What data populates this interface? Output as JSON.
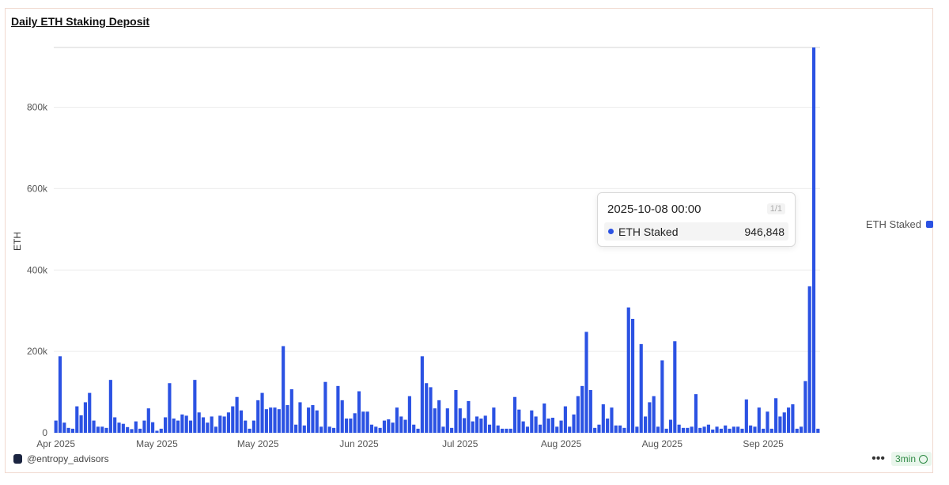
{
  "title": "Daily ETH Staking Deposit",
  "attribution": "@entropy_advisors",
  "refresh": "3min",
  "tooltip": {
    "date": "2025-10-08 00:00",
    "page": "1/1",
    "series": "ETH Staked",
    "value": "946,848"
  },
  "colors": {
    "bar": "#2b52e3",
    "grid": "#ececec"
  },
  "chart_data": {
    "type": "bar",
    "ylabel": "ETH",
    "ylim": [
      0,
      946848
    ],
    "yticks": [
      0,
      200000,
      400000,
      600000,
      800000
    ],
    "ytick_labels": [
      "0",
      "200k",
      "400k",
      "600k",
      "800k"
    ],
    "xtick_labels": [
      "Apr 2025",
      "May 2025",
      "May 2025",
      "Jun 2025",
      "Jul 2025",
      "Aug 2025",
      "Aug 2025",
      "Sep 2025"
    ],
    "xtick_index": [
      0,
      24,
      48,
      72,
      96,
      120,
      144,
      168
    ],
    "legend": {
      "position": "right",
      "entries": [
        "ETH Staked"
      ]
    },
    "series": [
      {
        "name": "ETH Staked",
        "values": [
          30000,
          188000,
          25000,
          12000,
          10000,
          65000,
          43000,
          75000,
          98000,
          30000,
          15000,
          15000,
          12000,
          130000,
          38000,
          25000,
          22000,
          14000,
          9000,
          28000,
          10000,
          30000,
          60000,
          26000,
          5000,
          10000,
          38000,
          122000,
          35000,
          30000,
          45000,
          42000,
          30000,
          130000,
          50000,
          38000,
          25000,
          40000,
          15000,
          42000,
          40000,
          50000,
          65000,
          88000,
          55000,
          30000,
          10000,
          30000,
          80000,
          98000,
          58000,
          62000,
          62000,
          58000,
          213000,
          68000,
          107000,
          20000,
          75000,
          18000,
          62000,
          68000,
          55000,
          15000,
          125000,
          15000,
          12000,
          115000,
          80000,
          35000,
          35000,
          48000,
          102000,
          52000,
          52000,
          20000,
          15000,
          12000,
          30000,
          33000,
          25000,
          62000,
          40000,
          32000,
          90000,
          20000,
          10000,
          188000,
          122000,
          112000,
          60000,
          80000,
          15000,
          60000,
          12000,
          105000,
          60000,
          36000,
          78000,
          28000,
          40000,
          35000,
          42000,
          20000,
          62000,
          18000,
          10000,
          10000,
          10000,
          88000,
          57000,
          28000,
          15000,
          55000,
          40000,
          20000,
          72000,
          35000,
          37000,
          15000,
          30000,
          65000,
          15000,
          45000,
          90000,
          115000,
          248000,
          105000,
          12000,
          20000,
          70000,
          35000,
          62000,
          18000,
          18000,
          12000,
          308000,
          280000,
          15000,
          218000,
          40000,
          75000,
          90000,
          15000,
          178000,
          10000,
          32000,
          225000,
          20000,
          12000,
          12000,
          15000,
          95000,
          12000,
          15000,
          20000,
          8000,
          15000,
          10000,
          18000,
          10000,
          15000,
          15000,
          10000,
          82000,
          18000,
          15000,
          62000,
          10000,
          52000,
          10000,
          85000,
          40000,
          50000,
          62000,
          70000,
          10000,
          15000,
          127000,
          360000,
          946848,
          10000
        ]
      }
    ]
  }
}
